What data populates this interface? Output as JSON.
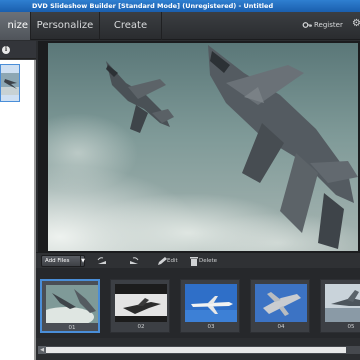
{
  "window": {
    "title": "DVD Slideshow Builder [Standard Mode] (Unregistered) - Untitled"
  },
  "tabs": [
    {
      "label": "Organize",
      "visible_label": "nize",
      "active": true
    },
    {
      "label": "Personalize",
      "active": false
    },
    {
      "label": "Create",
      "active": false
    }
  ],
  "topbar": {
    "register_label": "Register"
  },
  "storyboard": {
    "add_files_label": "Add Files",
    "tools": [
      {
        "icon": "rotate-left-icon"
      },
      {
        "icon": "rotate-right-icon"
      },
      {
        "icon": "edit-icon",
        "label": "Edit"
      },
      {
        "icon": "delete-icon",
        "label": "Delete"
      }
    ],
    "slides": [
      {
        "number": "01",
        "selected": true
      },
      {
        "number": "02",
        "selected": false
      },
      {
        "number": "03",
        "selected": false
      },
      {
        "number": "04",
        "selected": false
      },
      {
        "number": "05",
        "selected": false
      }
    ]
  },
  "colors": {
    "accent": "#4a8ed8",
    "titlebar": "#2f7fd0",
    "panel": "#2b2d30"
  }
}
